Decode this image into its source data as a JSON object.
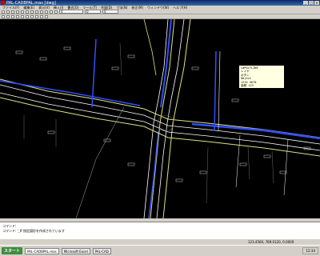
{
  "window": {
    "title": "PAL-CADBPAL.mas  [dwg]"
  },
  "menu": [
    "ファイル(F)",
    "編集(E)",
    "表示(V)",
    "挿入(I)",
    "書式(O)",
    "ツール(T)",
    "作図(D)",
    "寸法(N)",
    "修正(M)",
    "ウィンドウ(W)",
    "ヘルプ(H)"
  ],
  "toolbar": {
    "layer_select": "0",
    "scale_select": "0",
    "color_select": "0"
  },
  "infobox": {
    "lines": [
      "LWPOLYLINE",
      "レイヤ",
      "ボタン",
      "Object",
      "1234 5678",
      "面積 123"
    ]
  },
  "command": {
    "line1": "コマンド:",
    "line2": "コマンド: '_tf 指定図形を作成されています"
  },
  "status": {
    "coords": "123.4560, 789.0120, 0.0000"
  },
  "taskbar": {
    "start": "スタート",
    "task1": "PAL-CADBPAL.mas",
    "task2": "Microsoft Excel",
    "task3": "PAL-CAD",
    "clock": "12:34"
  }
}
